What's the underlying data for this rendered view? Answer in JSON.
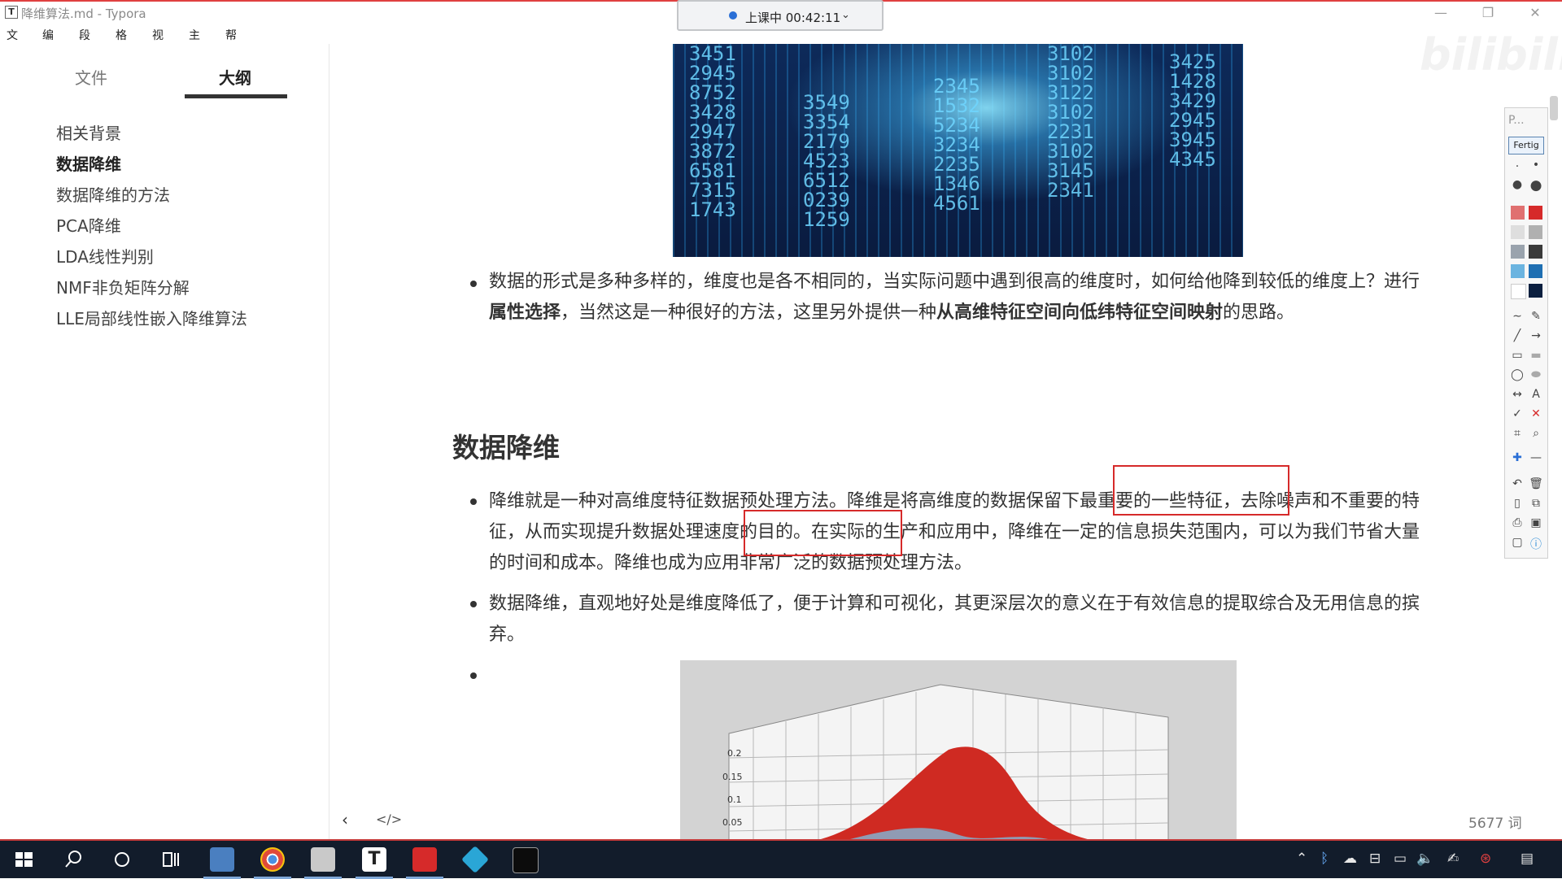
{
  "window": {
    "title": "降维算法.md - Typora",
    "app_icon": "T",
    "controls": [
      "—",
      "❐",
      "✕"
    ]
  },
  "class_timer": {
    "text": "上课中 00:42:11",
    "chevron": "⌄"
  },
  "menu": [
    "文件",
    "编辑",
    "段落",
    "格式",
    "视图",
    "主题",
    "帮助"
  ],
  "sidebar": {
    "tabs": [
      {
        "label": "文件",
        "active": false
      },
      {
        "label": "大纲",
        "active": true
      }
    ],
    "outline": [
      {
        "label": "相关背景",
        "active": false
      },
      {
        "label": "数据降维",
        "active": true
      },
      {
        "label": "数据降维的方法",
        "active": false
      },
      {
        "label": "PCA降维",
        "active": false
      },
      {
        "label": "LDA线性判别",
        "active": false
      },
      {
        "label": "NMF非负矩阵分解",
        "active": false
      },
      {
        "label": "LLE局部线性嵌入降维算法",
        "active": false
      }
    ]
  },
  "document": {
    "para1": {
      "t1": "数据的形式是多种多样的，维度也是各不相同的，当实际问题中遇到很高的维度时，如何给他降到较低的维度上？进行",
      "b1": "属性选择",
      "t2": "，当然这是一种很好的方法，这里另外提供一种",
      "b2": "从高维特征空间向低纬特征空间映射",
      "t3": "的思路。"
    },
    "heading": "数据降维",
    "para2": "降维就是一种对高维度特征数据预处理方法。降维是将高维度的数据保留下最重要的一些特征，去除噪声和不重要的特征，从而实现提升数据处理速度的目的。在实际的生产和应用中，降维在一定的信息损失范围内，可以为我们节省大量的时间和成本。降维也成为应用非常广泛的数据预处理方法。",
    "para3": "数据降维，直观地好处是维度降低了，便于计算和可视化，其更深层次的意义在于有效信息的提取综合及无用信息的摈弃。",
    "chart_ticks": [
      "0.2",
      "0.15",
      "0.1",
      "0.05"
    ],
    "word_count": "5677 词"
  },
  "editor_bar": {
    "prev": "‹",
    "source_toggle": "</>"
  },
  "watermark": "bilibili",
  "annotation_toolbar": {
    "title": "P...",
    "done_button": "Fertig",
    "colors": [
      "#d62a2a",
      "#b0b0b0",
      "#3a3a3a",
      "#1f6fb2",
      "#ffffff",
      "#0b1f3f"
    ]
  },
  "taskbar": {
    "apps": [
      "start",
      "search",
      "cortana",
      "task-view",
      "file-explorer",
      "chrome",
      "paint",
      "typora",
      "pdf-reader",
      "visual-studio",
      "terminal"
    ],
    "tray_icons": [
      "chevron-up",
      "bluetooth",
      "cloud",
      "network-folder",
      "monitor",
      "volume",
      "pen",
      "antivirus",
      "notifications"
    ]
  }
}
